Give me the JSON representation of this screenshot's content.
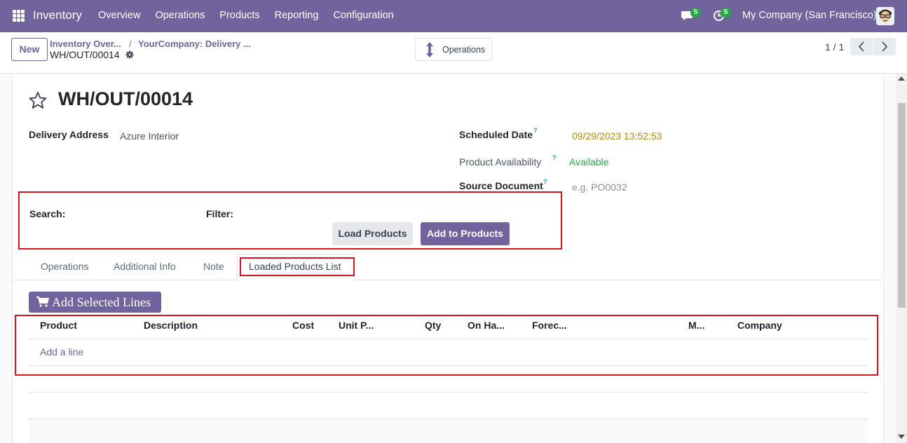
{
  "navbar": {
    "app_name": "Inventory",
    "menu": [
      "Overview",
      "Operations",
      "Products",
      "Reporting",
      "Configuration"
    ],
    "messages_count": "5",
    "activities_count": "5",
    "company": "My Company (San Francisco)"
  },
  "control_panel": {
    "new_label": "New",
    "breadcrumb_1": "Inventory Over...",
    "breadcrumb_sep": "/",
    "breadcrumb_2": "YourCompany: Delivery ...",
    "current_record": "WH/OUT/00014",
    "operations_label": "Operations",
    "pager": "1 / 1"
  },
  "form": {
    "title": "WH/OUT/00014",
    "delivery_address_label": "Delivery Address",
    "delivery_address_value": "Azure Interior",
    "scheduled_date_label": "Scheduled Date",
    "scheduled_date_value": "09/29/2023 13:52:53",
    "product_availability_label": "Product Availability",
    "product_availability_value": "Available",
    "source_document_label": "Source Document",
    "source_document_placeholder": "e.g. PO0032",
    "help_mark": "?",
    "search_label": "Search:",
    "filter_label": "Filter:",
    "load_products_label": "Load Products",
    "add_to_products_label": "Add to Products"
  },
  "tabs": [
    "Operations",
    "Additional Info",
    "Note",
    "Loaded Products List"
  ],
  "lines": {
    "add_selected_label": "Add Selected Lines",
    "columns": [
      "Product",
      "Description",
      "Cost",
      "Unit P...",
      "Qty",
      "On Ha...",
      "Forec...",
      "M...",
      "Company"
    ],
    "add_line_label": "Add a line"
  },
  "colors": {
    "brand": "#71639e",
    "scheduled_date": "#b8860b",
    "available": "#28a745",
    "highlight_box": "#d9121e",
    "badge": "#28a745"
  }
}
